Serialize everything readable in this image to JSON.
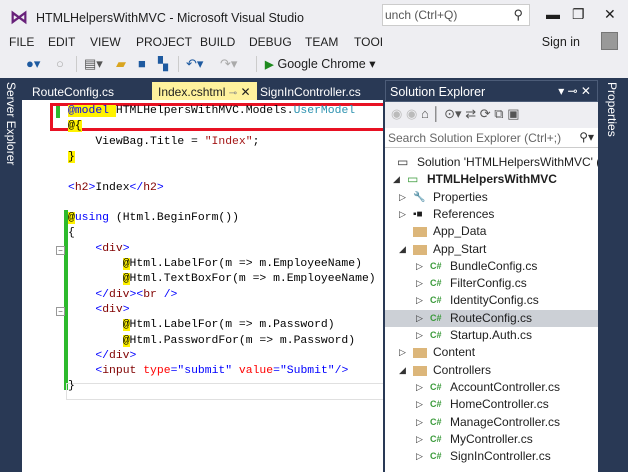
{
  "window": {
    "title": "HTMLHelpersWithMVC - Microsoft Visual Studio",
    "quick_launch": "unch (Ctrl+Q)",
    "sign_in": "Sign in"
  },
  "menu": [
    "FILE",
    "EDIT",
    "VIEW",
    "PROJECT",
    "BUILD",
    "DEBUG",
    "TEAM",
    "TOOI"
  ],
  "toolbar": {
    "run_target": "Google Chrome"
  },
  "side_tabs": {
    "left": "Server Explorer",
    "right": "Properties"
  },
  "tabs": [
    {
      "label": "RouteConfig.cs"
    },
    {
      "label": "Index.cshtml",
      "active": true
    },
    {
      "label": "SignInController.cs"
    }
  ],
  "code": [
    [
      [
        "hl kw",
        "@model"
      ],
      [
        "hl",
        " "
      ],
      [
        "",
        "HTMLHelpersWithMVC.Models."
      ],
      [
        "ty",
        "UserModel"
      ]
    ],
    [
      [
        "hl",
        "@{"
      ]
    ],
    [
      [
        "",
        "    ViewBag.Title = "
      ],
      [
        "st",
        "\"Index\""
      ],
      [
        "",
        ";"
      ]
    ],
    [
      [
        "hl",
        "}"
      ]
    ],
    [],
    [
      [
        "kw",
        "<"
      ],
      [
        "tg",
        "h2"
      ],
      [
        "kw",
        ">"
      ],
      [
        "",
        "Index"
      ],
      [
        "kw",
        "</"
      ],
      [
        "tg",
        "h2"
      ],
      [
        "kw",
        ">"
      ]
    ],
    [],
    [
      [
        "hl",
        "@"
      ],
      [
        "kw",
        "using"
      ],
      [
        "",
        " (Html.BeginForm())"
      ]
    ],
    [
      [
        "",
        "{"
      ]
    ],
    [
      [
        "",
        "    "
      ],
      [
        "kw",
        "<"
      ],
      [
        "tg",
        "div"
      ],
      [
        "kw",
        ">"
      ]
    ],
    [
      [
        "",
        "        "
      ],
      [
        "hl",
        "@"
      ],
      [
        "",
        "Html.LabelFor(m => m.EmployeeName)"
      ]
    ],
    [
      [
        "",
        "        "
      ],
      [
        "hl",
        "@"
      ],
      [
        "",
        "Html.TextBoxFor(m => m.EmployeeName)"
      ]
    ],
    [
      [
        "",
        "    "
      ],
      [
        "kw",
        "</"
      ],
      [
        "tg",
        "div"
      ],
      [
        "kw",
        "><"
      ],
      [
        "tg",
        "br"
      ],
      [
        "kw",
        " />"
      ]
    ],
    [
      [
        "",
        "    "
      ],
      [
        "kw",
        "<"
      ],
      [
        "tg",
        "div"
      ],
      [
        "kw",
        ">"
      ]
    ],
    [
      [
        "",
        "        "
      ],
      [
        "hl",
        "@"
      ],
      [
        "",
        "Html.LabelFor(m => m.Password)"
      ]
    ],
    [
      [
        "",
        "        "
      ],
      [
        "hl",
        "@"
      ],
      [
        "",
        "Html.PasswordFor(m => m.Password)"
      ]
    ],
    [
      [
        "",
        "    "
      ],
      [
        "kw",
        "</"
      ],
      [
        "tg",
        "div"
      ],
      [
        "kw",
        ">"
      ]
    ],
    [
      [
        "",
        "    "
      ],
      [
        "kw",
        "<"
      ],
      [
        "tg",
        "input"
      ],
      [
        "at",
        " type"
      ],
      [
        "kw",
        "="
      ],
      [
        "sv",
        "\"submit\""
      ],
      [
        "at",
        " value"
      ],
      [
        "kw",
        "="
      ],
      [
        "sv",
        "\"Submit\""
      ],
      [
        "kw",
        "/>"
      ]
    ],
    [
      [
        "",
        "}"
      ]
    ]
  ],
  "solution_explorer": {
    "title": "Solution Explorer",
    "search_placeholder": "Search Solution Explorer (Ctrl+;)",
    "items": [
      {
        "label": "Solution 'HTMLHelpersWithMVC' (1",
        "level": 0,
        "icon": "solution-icon",
        "arrow": ""
      },
      {
        "label": "HTMLHelpersWithMVC",
        "level": 1,
        "icon": "project-icon",
        "arrow": "expanded",
        "bold": true
      },
      {
        "label": "Properties",
        "level": 2,
        "icon": "wrench-icon",
        "arrow": "collapsed"
      },
      {
        "label": "References",
        "level": 2,
        "icon": "references-icon",
        "arrow": "collapsed"
      },
      {
        "label": "App_Data",
        "level": 2,
        "icon": "folder-icon",
        "arrow": ""
      },
      {
        "label": "App_Start",
        "level": 2,
        "icon": "folder-open-icon",
        "arrow": "expanded"
      },
      {
        "label": "BundleConfig.cs",
        "level": 3,
        "icon": "csharp-icon",
        "arrow": "collapsed"
      },
      {
        "label": "FilterConfig.cs",
        "level": 3,
        "icon": "csharp-icon",
        "arrow": "collapsed"
      },
      {
        "label": "IdentityConfig.cs",
        "level": 3,
        "icon": "csharp-icon",
        "arrow": "collapsed"
      },
      {
        "label": "RouteConfig.cs",
        "level": 3,
        "icon": "csharp-icon",
        "arrow": "collapsed",
        "selected": true
      },
      {
        "label": "Startup.Auth.cs",
        "level": 3,
        "icon": "csharp-icon",
        "arrow": "collapsed"
      },
      {
        "label": "Content",
        "level": 2,
        "icon": "folder-icon",
        "arrow": "collapsed"
      },
      {
        "label": "Controllers",
        "level": 2,
        "icon": "folder-open-icon",
        "arrow": "expanded"
      },
      {
        "label": "AccountController.cs",
        "level": 3,
        "icon": "csharp-icon",
        "arrow": "collapsed"
      },
      {
        "label": "HomeController.cs",
        "level": 3,
        "icon": "csharp-icon",
        "arrow": "collapsed"
      },
      {
        "label": "ManageController.cs",
        "level": 3,
        "icon": "csharp-icon",
        "arrow": "collapsed"
      },
      {
        "label": "MyController.cs",
        "level": 3,
        "icon": "csharp-icon",
        "arrow": "collapsed"
      },
      {
        "label": "SignInController.cs",
        "level": 3,
        "icon": "csharp-icon",
        "arrow": "collapsed"
      }
    ]
  },
  "colors": {
    "chrome": "#293955",
    "highlight_box": "#e81123",
    "active_tab": "#fff29d"
  }
}
